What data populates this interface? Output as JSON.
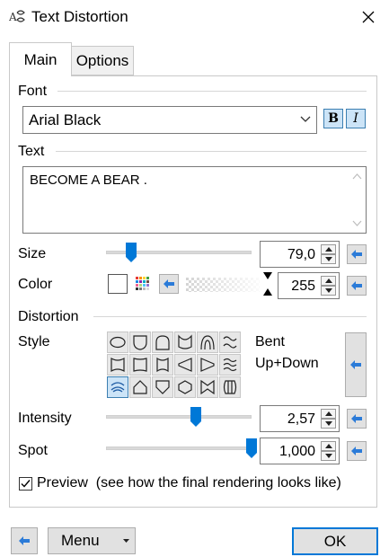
{
  "window": {
    "title": "Text Distortion",
    "title_icon": "text-distortion-app-icon",
    "close_icon": "close-icon"
  },
  "tabs": [
    {
      "label": "Main",
      "active": true
    },
    {
      "label": "Options",
      "active": false
    }
  ],
  "font": {
    "group_label": "Font",
    "value": "Arial Black",
    "bold_label": "B",
    "italic_label": "I",
    "bold_active": true,
    "italic_active": true
  },
  "text": {
    "group_label": "Text",
    "value": "BECOME A BEAR ."
  },
  "size": {
    "label": "Size",
    "value": "79,0",
    "slider_fraction": 0.17
  },
  "color": {
    "label": "Color",
    "swatch": "#ffffff",
    "alpha_value": "255"
  },
  "distortion": {
    "group_label": "Distortion",
    "style_label": "Style",
    "style_name_line1": "Bent",
    "style_name_line2": "Up+Down",
    "selected_index": 12,
    "styles": [
      "oval",
      "shield",
      "arch-up",
      "valley",
      "arch",
      "wave",
      "pinch-horizontal",
      "flag",
      "bulge",
      "cone-left",
      "cone-right",
      "double-wave",
      "bent-up-down",
      "house",
      "shield-down",
      "hexagon",
      "bow-tie",
      "barrel"
    ]
  },
  "intensity": {
    "label": "Intensity",
    "value": "2,57",
    "slider_fraction": 0.62
  },
  "spot": {
    "label": "Spot",
    "value": "1,000",
    "slider_fraction": 1.0
  },
  "preview": {
    "checked": true,
    "label": "Preview  (see how the final rendering looks like)"
  },
  "footer": {
    "menu_label": "Menu",
    "ok_label": "OK"
  },
  "colors": {
    "accent": "#0078d7",
    "thumb": "#0078d7",
    "selected_bg": "#cce4f7",
    "arrow_blue": "#2b7bd8"
  }
}
